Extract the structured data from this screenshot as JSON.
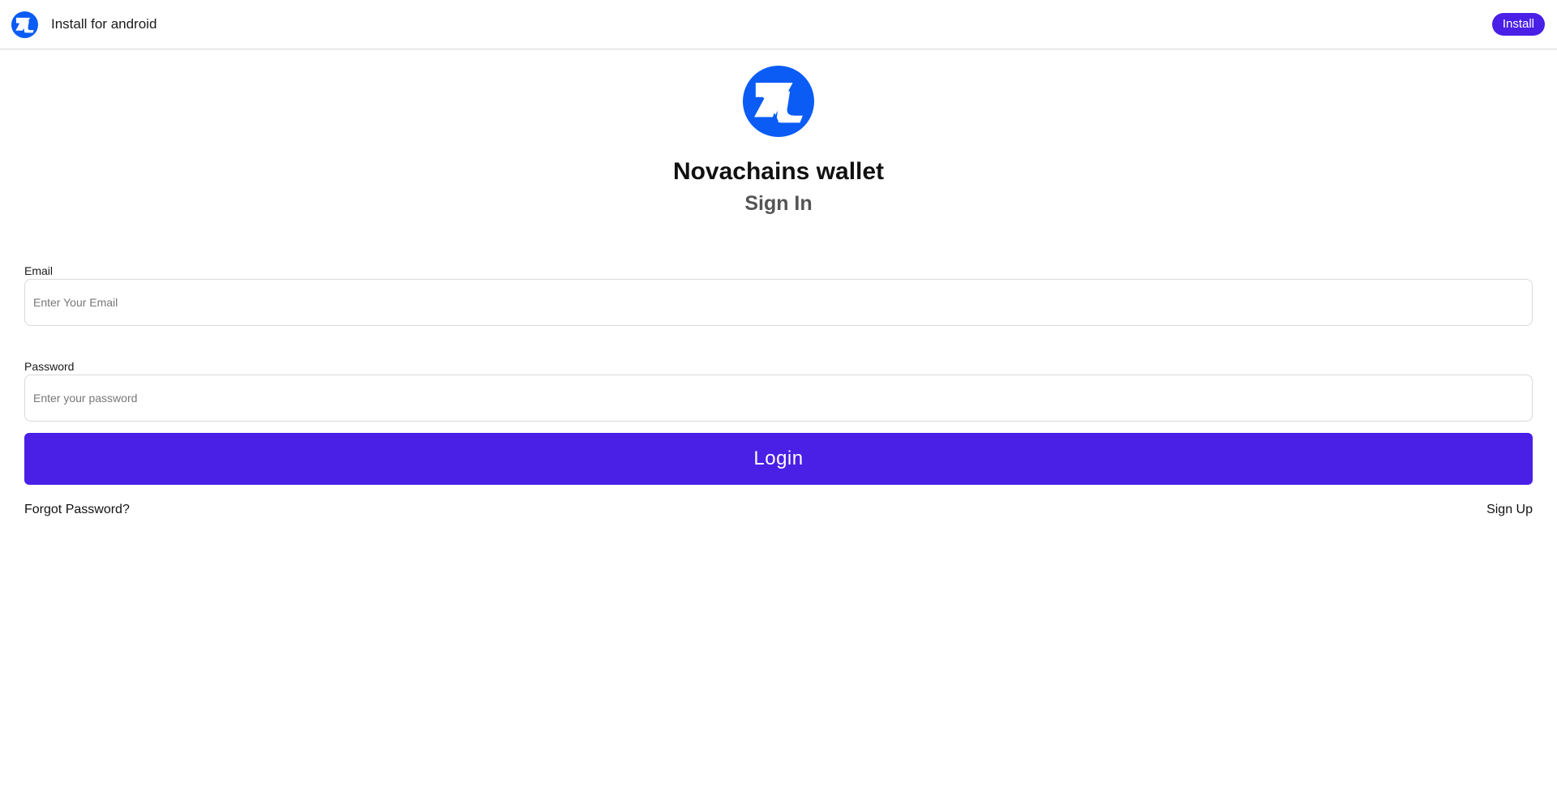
{
  "banner": {
    "logo_icon": "novachains-logo-icon",
    "text": "Install for android",
    "install_label": "Install"
  },
  "brand": {
    "logo_icon": "novachains-logo-icon",
    "app_name": "Novachains wallet",
    "page_title": "Sign In"
  },
  "form": {
    "email": {
      "label": "Email",
      "value": "",
      "placeholder": "Enter Your Email"
    },
    "password": {
      "label": "Password",
      "value": "",
      "placeholder": "Enter your password"
    },
    "login_label": "Login"
  },
  "links": {
    "forgot_password": "Forgot Password?",
    "sign_up": "Sign Up"
  },
  "colors": {
    "primary": "#4a1fe6",
    "logo_blue": "#0a5cf5"
  }
}
